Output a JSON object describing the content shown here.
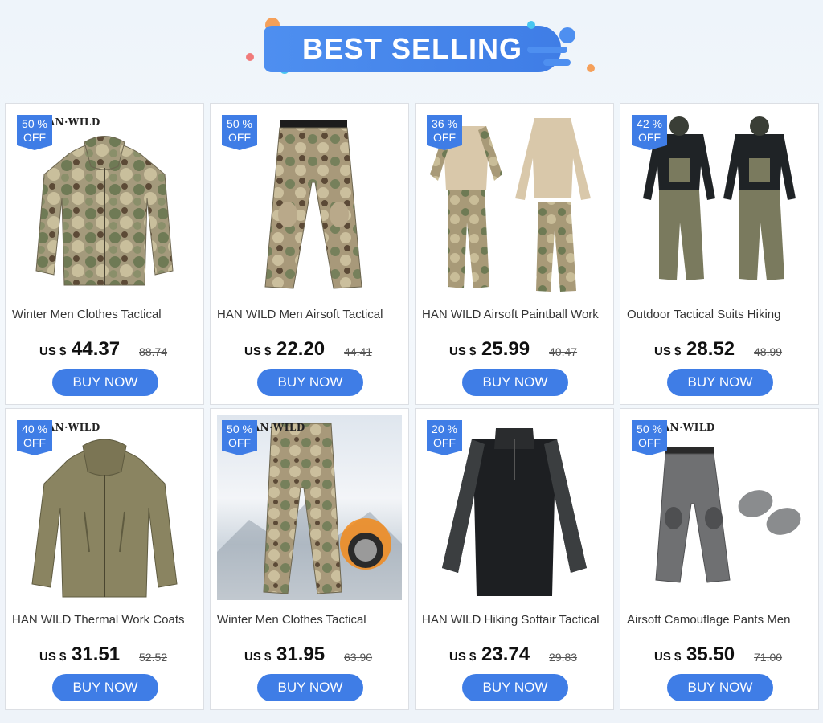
{
  "banner": {
    "title": "BEST SELLING"
  },
  "colors": {
    "accent": "#3f7de6",
    "banner": "#4e8ff0",
    "dot_orange": "#f5a05a",
    "dot_cyan": "#49c6f0"
  },
  "products": [
    {
      "brand": "HAN·WILD",
      "discount": "50 %",
      "off": "OFF",
      "title": "Winter Men Clothes Tactical",
      "currency": "US $",
      "price": "44.37",
      "old_price": "88.74",
      "cta": "BUY NOW",
      "image": "camo-jacket"
    },
    {
      "brand": "",
      "discount": "50 %",
      "off": "OFF",
      "title": "HAN WILD Men Airsoft Tactical",
      "currency": "US $",
      "price": "22.20",
      "old_price": "44.41",
      "cta": "BUY NOW",
      "image": "camo-pants"
    },
    {
      "brand": "",
      "discount": "36 %",
      "off": "OFF",
      "title": "HAN WILD Airsoft Paintball Work",
      "currency": "US $",
      "price": "25.99",
      "old_price": "40.47",
      "cta": "BUY NOW",
      "image": "combat-shirt-set"
    },
    {
      "brand": "",
      "discount": "42 %",
      "off": "OFF",
      "title": "Outdoor Tactical Suits Hiking",
      "currency": "US $",
      "price": "28.52",
      "old_price": "48.99",
      "cta": "BUY NOW",
      "image": "tactical-suit-models"
    },
    {
      "brand": "HAN·WILD",
      "discount": "40 %",
      "off": "OFF",
      "title": "HAN WILD Thermal Work Coats",
      "currency": "US $",
      "price": "31.51",
      "old_price": "52.52",
      "cta": "BUY NOW",
      "image": "softshell-jacket"
    },
    {
      "brand": "HAN·WILD",
      "discount": "50 %",
      "off": "OFF",
      "title": "Winter Men Clothes Tactical",
      "currency": "US $",
      "price": "31.95",
      "old_price": "63.90",
      "cta": "BUY NOW",
      "image": "fleece-pants-snow"
    },
    {
      "brand": "",
      "discount": "20 %",
      "off": "OFF",
      "title": "HAN WILD Hiking Softair Tactical",
      "currency": "US $",
      "price": "23.74",
      "old_price": "29.83",
      "cta": "BUY NOW",
      "image": "black-combat-shirt"
    },
    {
      "brand": "HAN·WILD",
      "discount": "50 %",
      "off": "OFF",
      "title": "Airsoft Camouflage Pants Men",
      "currency": "US $",
      "price": "35.50",
      "old_price": "71.00",
      "cta": "BUY NOW",
      "image": "grey-pants-kneepads"
    }
  ]
}
